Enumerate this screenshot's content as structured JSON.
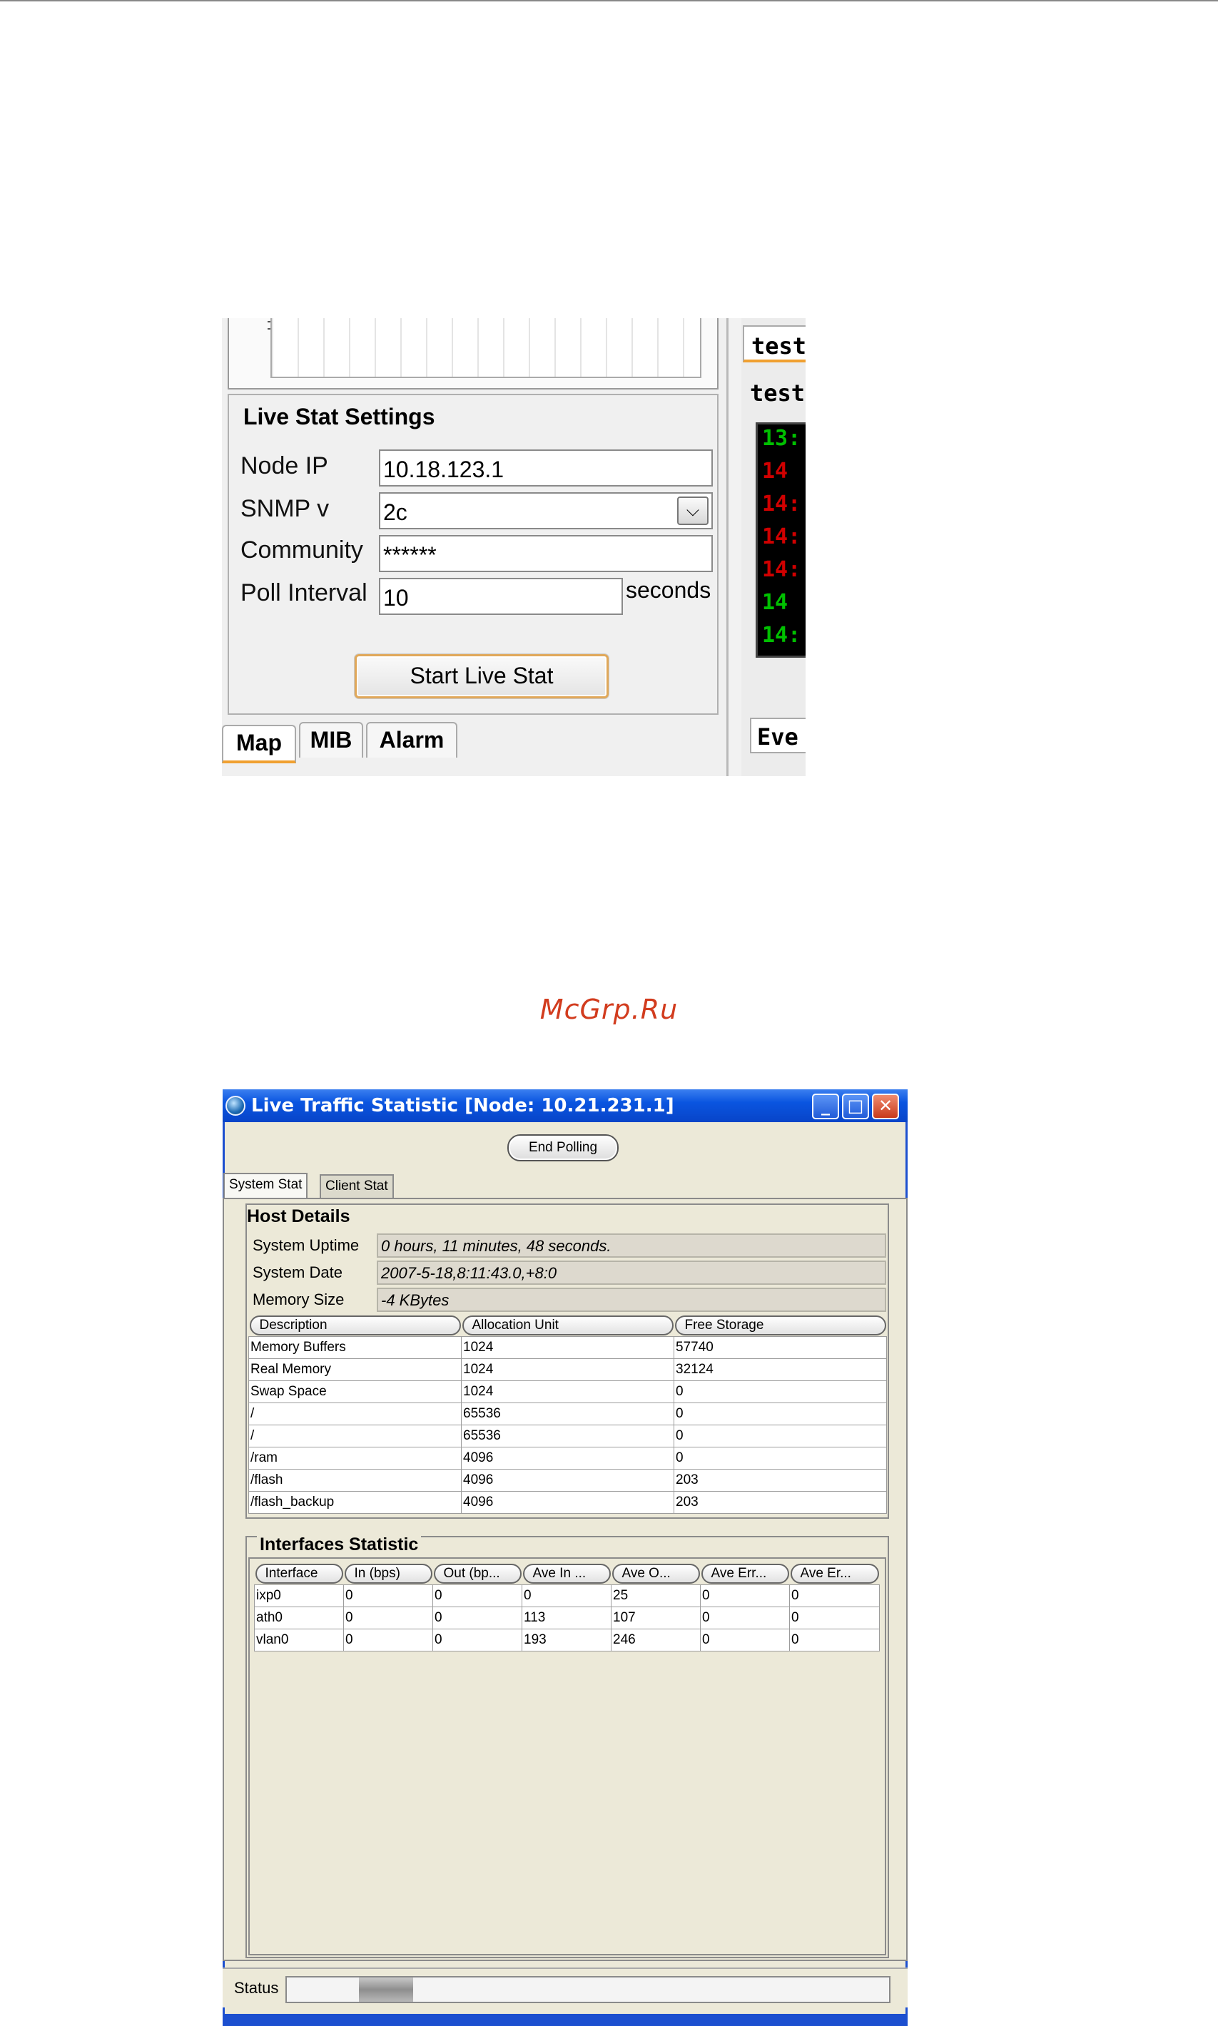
{
  "shot1": {
    "settings_title": "Live Stat Settings",
    "node_ip_label": "Node IP",
    "node_ip_value": "10.18.123.1",
    "snmp_label": "SNMP v",
    "snmp_value": "2c",
    "community_label": "Community",
    "community_value": "******",
    "poll_label": "Poll Interval",
    "poll_value": "10",
    "poll_unit": "seconds",
    "start_button": "Start Live Stat",
    "tabs": [
      "Map",
      "MIB",
      "Alarm"
    ],
    "right_tab_top": "test",
    "right_tab_sub": "test",
    "right_tab_bottom": "Eve",
    "console_lines": [
      {
        "text": "13:",
        "color": "#00c000"
      },
      {
        "text": "14",
        "color": "#d00000"
      },
      {
        "text": "14:",
        "color": "#d00000"
      },
      {
        "text": "14:",
        "color": "#d00000"
      },
      {
        "text": "14:",
        "color": "#d00000"
      },
      {
        "text": "14",
        "color": "#00c000"
      },
      {
        "text": "14:",
        "color": "#00c000"
      }
    ],
    "accent_color": "#f0a030"
  },
  "caption": "McGrp.Ru",
  "window": {
    "title": "Live Traffic Statistic [Node: 10.21.231.1]",
    "end_polling": "End Polling",
    "tabs": [
      "System Stat",
      "Client Stat"
    ],
    "host_details_title": "Host Details",
    "host_rows": [
      {
        "label": "System Uptime",
        "value": "0 hours, 11 minutes, 48 seconds."
      },
      {
        "label": "System Date",
        "value": "2007-5-18,8:11:43.0,+8:0"
      },
      {
        "label": "Memory Size",
        "value": "-4 KBytes"
      }
    ],
    "memory_columns": [
      "Description",
      "Allocation Unit",
      "Free Storage"
    ],
    "memory_rows": [
      [
        "Memory Buffers",
        "1024",
        "57740"
      ],
      [
        "Real Memory",
        "1024",
        "32124"
      ],
      [
        "Swap Space",
        "1024",
        "0"
      ],
      [
        "/",
        "65536",
        "0"
      ],
      [
        "/",
        "65536",
        "0"
      ],
      [
        "/ram",
        "4096",
        "0"
      ],
      [
        "/flash",
        "4096",
        "203"
      ],
      [
        "/flash_backup",
        "4096",
        "203"
      ]
    ],
    "interfaces_title": "Interfaces Statistic",
    "interface_columns": [
      "Interface",
      "In (bps)",
      "Out (bp...",
      "Ave In ...",
      "Ave O...",
      "Ave Err...",
      "Ave Er..."
    ],
    "interface_rows": [
      [
        "ixp0",
        "0",
        "0",
        "0",
        "25",
        "0",
        "0"
      ],
      [
        "ath0",
        "0",
        "0",
        "113",
        "107",
        "0",
        "0"
      ],
      [
        "vlan0",
        "0",
        "0",
        "193",
        "246",
        "0",
        "0"
      ]
    ],
    "status_label": "Status",
    "status_progress_start": 0.12,
    "status_progress_end": 0.21,
    "titlebar_color": "#0a55e0"
  }
}
